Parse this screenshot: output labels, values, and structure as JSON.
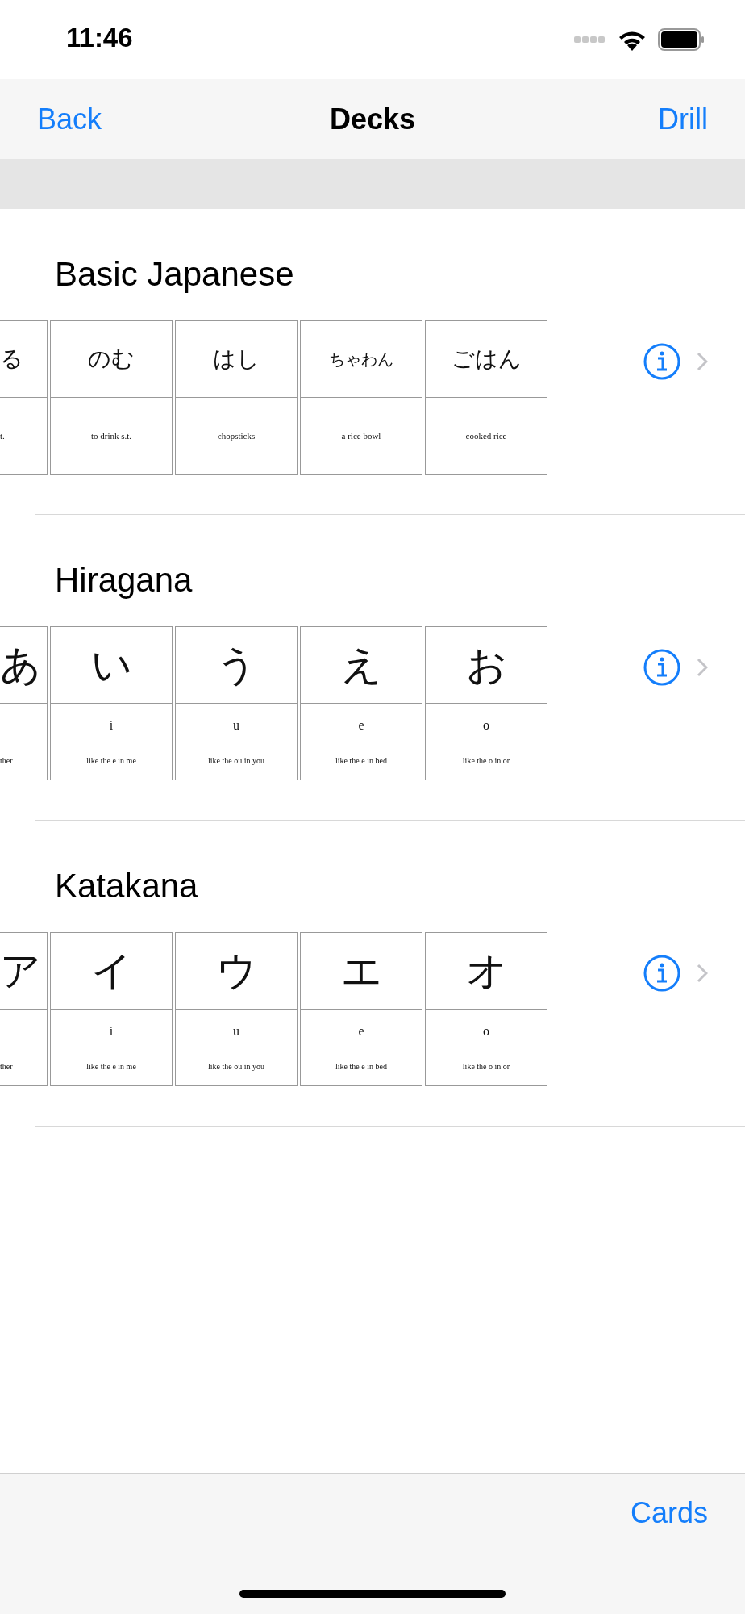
{
  "status_bar": {
    "time": "11:46"
  },
  "nav_bar": {
    "back": "Back",
    "title": "Decks",
    "action": "Drill"
  },
  "decks": [
    {
      "title": "Basic Japanese",
      "kind": "vocab",
      "cards": [
        {
          "kind": "partial",
          "front": "る",
          "back": "t."
        },
        {
          "kind": "full",
          "front": "のむ",
          "back": "to drink s.t."
        },
        {
          "kind": "full",
          "front": "はし",
          "back": "chopsticks"
        },
        {
          "kind": "full",
          "front": "ちゃわん",
          "back": "a rice bowl"
        },
        {
          "kind": "full",
          "front": "ごはん",
          "back": "cooked rice"
        }
      ]
    },
    {
      "title": "Hiragana",
      "kind": "kana",
      "cards": [
        {
          "kind": "partial",
          "front": "あ",
          "note": "ther"
        },
        {
          "kind": "full",
          "front": "い",
          "back": "i",
          "note": "like the e in me"
        },
        {
          "kind": "full",
          "front": "う",
          "back": "u",
          "note": "like the ou in you"
        },
        {
          "kind": "full",
          "front": "え",
          "back": "e",
          "note": "like the e in bed"
        },
        {
          "kind": "full",
          "front": "お",
          "back": "o",
          "note": "like the o in or"
        }
      ]
    },
    {
      "title": "Katakana",
      "kind": "kana",
      "cards": [
        {
          "kind": "partial",
          "front": "ア",
          "note": "ther"
        },
        {
          "kind": "full",
          "front": "イ",
          "back": "i",
          "note": "like the e in me"
        },
        {
          "kind": "full",
          "front": "ウ",
          "back": "u",
          "note": "like the ou in you"
        },
        {
          "kind": "full",
          "front": "エ",
          "back": "e",
          "note": "like the e in bed"
        },
        {
          "kind": "full",
          "front": "オ",
          "back": "o",
          "note": "like the o in or"
        }
      ]
    }
  ],
  "toolbar": {
    "button": "Cards"
  }
}
